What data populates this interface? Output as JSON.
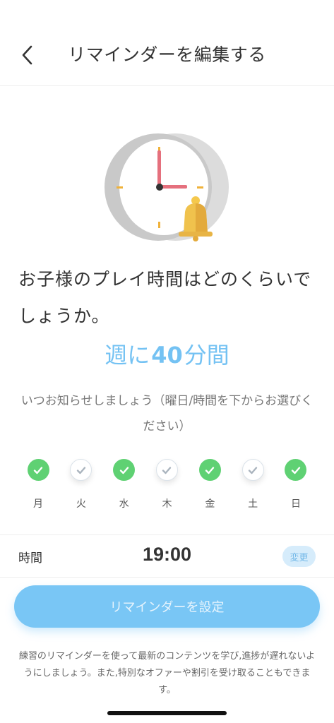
{
  "header": {
    "title": "リマインダーを編集する",
    "back_icon": "chevron-left-icon"
  },
  "illustration": {
    "icon": "alarm-clock-bell-icon"
  },
  "question": "お子様のプレイ時間はどのくらいでしょうか。",
  "weekly": {
    "prefix": "週に",
    "minutes": "40",
    "suffix": "分間"
  },
  "hint": "いつお知らせしましょう（曜日/時間を下からお選びください）",
  "days": [
    {
      "label": "月",
      "checked": true
    },
    {
      "label": "火",
      "checked": false
    },
    {
      "label": "水",
      "checked": true
    },
    {
      "label": "木",
      "checked": false
    },
    {
      "label": "金",
      "checked": true
    },
    {
      "label": "土",
      "checked": false
    },
    {
      "label": "日",
      "checked": true
    }
  ],
  "time": {
    "label": "時間",
    "value": "19:00",
    "change_label": "変更"
  },
  "submit_label": "リマインダーを設定",
  "footer": "練習のリマインダーを使って最新のコンテンツを学び,進捗が遅れないようにしましょう。また,特別なオファーや割引を受け取ることもできます。",
  "colors": {
    "accent": "#74c2f3",
    "check_on": "#5fd173",
    "button": "#79c6f5"
  }
}
